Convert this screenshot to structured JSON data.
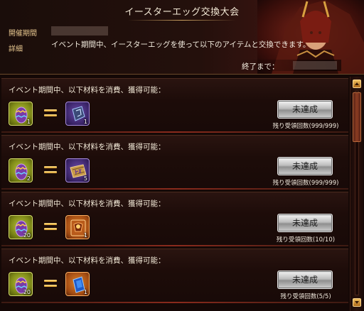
{
  "header": {
    "title": "イースターエッグ交換大会",
    "period_label": "開催期間",
    "detail_label": "詳細",
    "detail_text": "イベント期間中、イースターエッグを使って以下のアイテムと交換できます。",
    "end_label": "終了まで："
  },
  "exchanges": [
    {
      "title": "イベント期間中、以下材料を消費、獲得可能：",
      "cost_icon": "purple-easter-egg-icon",
      "cost_qty": "1",
      "reward_icon": "rune-stone-icon",
      "reward_qty": "1",
      "button_label": "未達成",
      "remaining": "残り受領回数(999/999)"
    },
    {
      "title": "イベント期間中、以下材料を消費、獲得可能：",
      "cost_icon": "purple-easter-egg-icon",
      "cost_qty": "2",
      "reward_icon": "exp-scroll-icon",
      "reward_qty": "5",
      "button_label": "未達成",
      "remaining": "残り受領回数(999/999)"
    },
    {
      "title": "イベント期間中、以下材料を消費、獲得可能：",
      "cost_icon": "purple-easter-egg-icon",
      "cost_qty": "20",
      "reward_icon": "hero-card-icon",
      "reward_qty": "1",
      "button_label": "未達成",
      "remaining": "残り受領回数(10/10)"
    },
    {
      "title": "イベント期間中、以下材料を消費、獲得可能：",
      "cost_icon": "purple-easter-egg-icon",
      "cost_qty": "20",
      "reward_icon": "blue-crystal-card-icon",
      "reward_qty": "1",
      "button_label": "未達成",
      "remaining": "残り受領回数(5/5)"
    }
  ],
  "scrollbar": {
    "up_icon": "arrow-up-icon",
    "down_icon": "arrow-down-icon"
  },
  "colors": {
    "background": "#140806",
    "label_gold": "#e8c890",
    "button_silver": "#cfcfcf"
  }
}
